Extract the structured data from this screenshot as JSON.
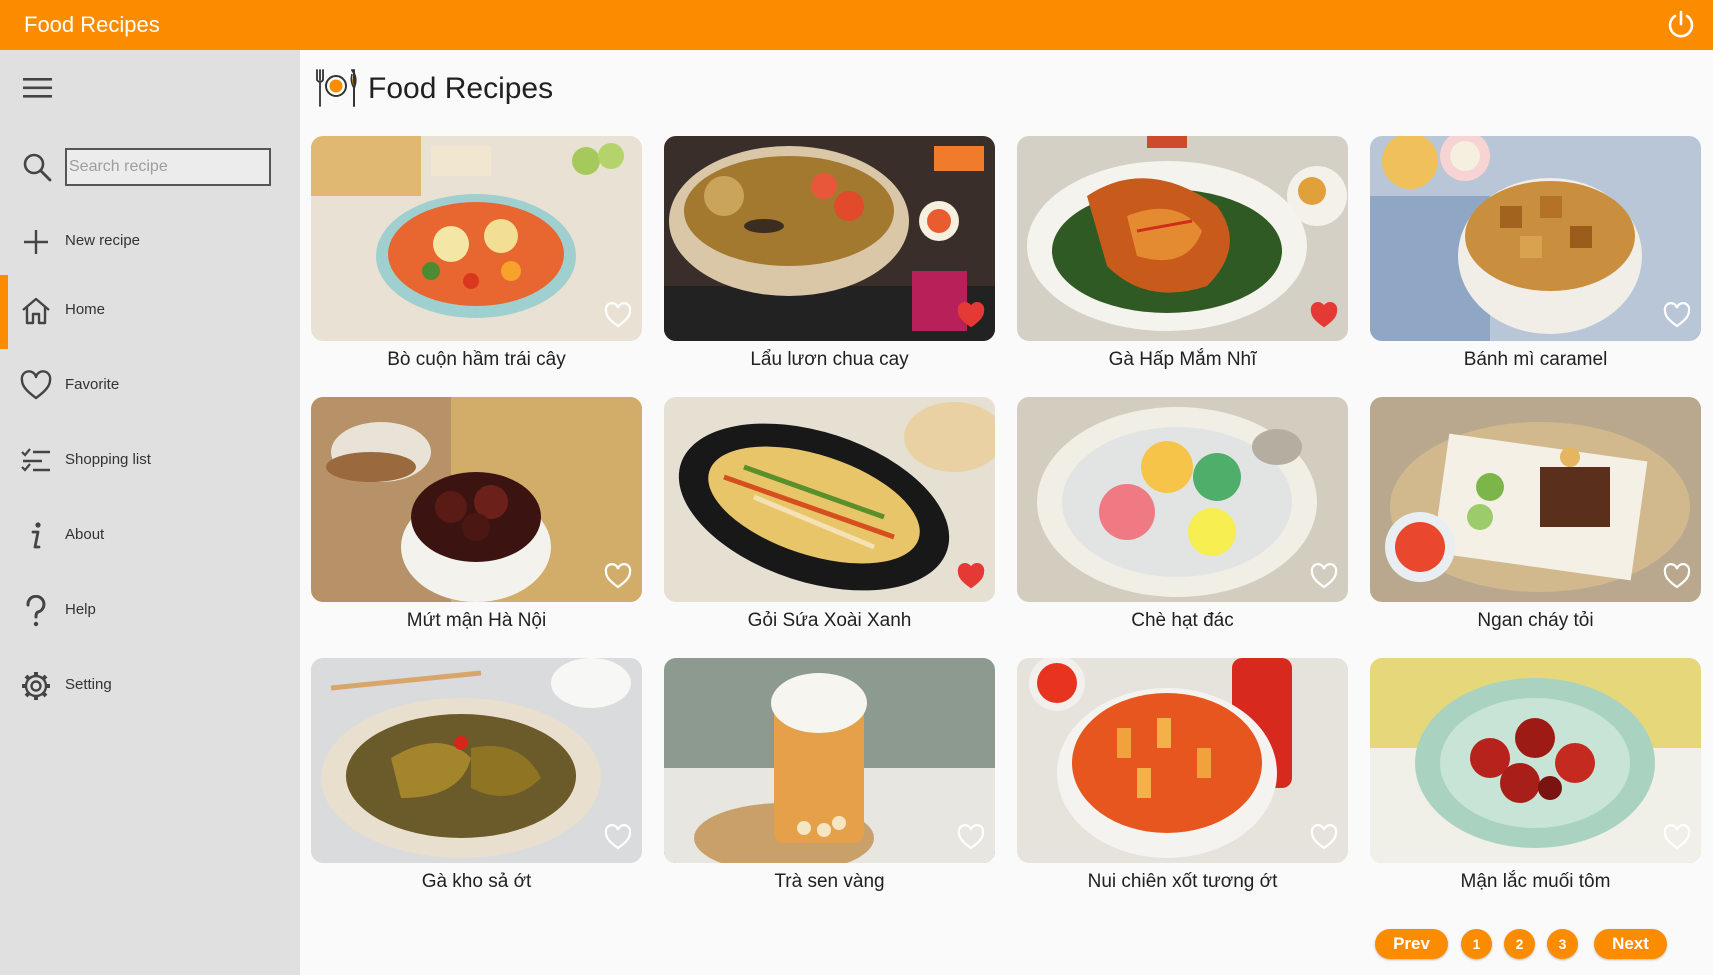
{
  "app": {
    "title": "Food Recipes"
  },
  "sidebar": {
    "search_placeholder": "Search recipe",
    "items": [
      {
        "label": "New recipe",
        "icon": "plus-icon"
      },
      {
        "label": "Home",
        "icon": "home-icon",
        "active": true
      },
      {
        "label": "Favorite",
        "icon": "heart-icon"
      },
      {
        "label": "Shopping list",
        "icon": "list-icon"
      },
      {
        "label": "About",
        "icon": "info-icon"
      },
      {
        "label": "Help",
        "icon": "question-icon"
      },
      {
        "label": "Setting",
        "icon": "gear-icon"
      }
    ]
  },
  "main": {
    "title": "Food Recipes",
    "recipes": [
      {
        "name": "Bò cuộn hầm trái cây",
        "favorite": false
      },
      {
        "name": "Lẩu lươn chua cay",
        "favorite": true
      },
      {
        "name": "Gà Hấp Mắm Nhĩ",
        "favorite": true
      },
      {
        "name": "Bánh mì caramel",
        "favorite": false
      },
      {
        "name": "Mứt mận Hà Nội",
        "favorite": false
      },
      {
        "name": "Gỏi Sứa Xoài Xanh",
        "favorite": true
      },
      {
        "name": "Chè hạt đác",
        "favorite": false
      },
      {
        "name": "Ngan cháy tỏi",
        "favorite": false
      },
      {
        "name": "Gà kho sả ớt",
        "favorite": false
      },
      {
        "name": "Trà sen vàng",
        "favorite": false
      },
      {
        "name": "Nui chiên xốt tương ớt",
        "favorite": false
      },
      {
        "name": "Mận lắc muối tôm",
        "favorite": false
      }
    ]
  },
  "pagination": {
    "prev": "Prev",
    "pages": [
      "1",
      "2",
      "3"
    ],
    "next": "Next"
  },
  "colors": {
    "accent": "#fb8c00",
    "sidebar_bg": "#e0e0e0",
    "heart_active": "#e53935"
  }
}
